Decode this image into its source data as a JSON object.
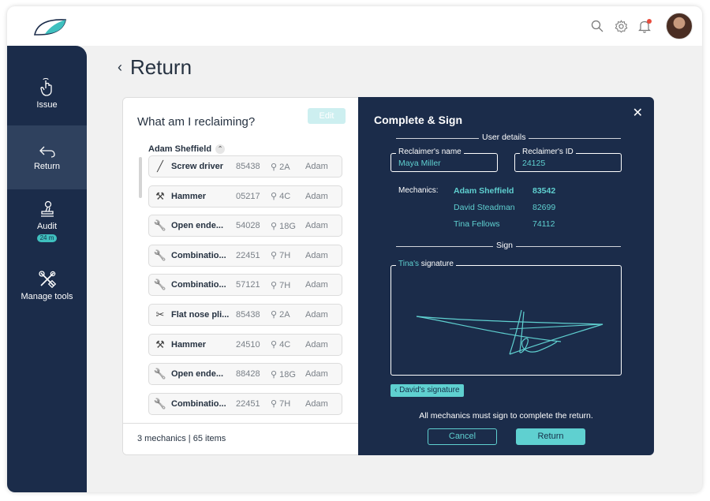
{
  "header": {
    "logo_icon": "leaf-logo",
    "icons": [
      "search-icon",
      "gear-icon",
      "bell-icon"
    ]
  },
  "sidebar": {
    "items": [
      {
        "label": "Issue",
        "icon": "hand-tap-icon"
      },
      {
        "label": "Return",
        "icon": "return-arrow-icon",
        "active": true
      },
      {
        "label": "Audit",
        "icon": "stamp-icon",
        "badge": "24 m"
      },
      {
        "label": "Manage tools",
        "icon": "tools-icon"
      }
    ]
  },
  "page": {
    "back_icon": "chevron-left-icon",
    "title": "Return"
  },
  "left_panel": {
    "heading": "What am I reclaiming?",
    "edit_label": "Edit",
    "group_name": "Adam Sheffield",
    "tools": [
      {
        "icon": "screwdriver-icon",
        "name": "Screw driver",
        "id": "85438",
        "location": "2A",
        "owner": "Adam"
      },
      {
        "icon": "hammer-icon",
        "name": "Hammer",
        "id": "05217",
        "location": "4C",
        "owner": "Adam"
      },
      {
        "icon": "wrench-icon",
        "name": "Open ende...",
        "id": "54028",
        "location": "18G",
        "owner": "Adam"
      },
      {
        "icon": "wrench-icon",
        "name": "Combinatio...",
        "id": "22451",
        "location": "7H",
        "owner": "Adam"
      },
      {
        "icon": "wrench-icon",
        "name": "Combinatio...",
        "id": "57121",
        "location": "7H",
        "owner": "Adam"
      },
      {
        "icon": "pliers-icon",
        "name": "Flat nose pli...",
        "id": "85438",
        "location": "2A",
        "owner": "Adam"
      },
      {
        "icon": "hammer-icon",
        "name": "Hammer",
        "id": "24510",
        "location": "4C",
        "owner": "Adam"
      },
      {
        "icon": "wrench-icon",
        "name": "Open ende...",
        "id": "88428",
        "location": "18G",
        "owner": "Adam"
      },
      {
        "icon": "wrench-icon",
        "name": "Combinatio...",
        "id": "22451",
        "location": "7H",
        "owner": "Adam"
      }
    ],
    "footer": "3 mechanics | 65 items"
  },
  "right_panel": {
    "title": "Complete & Sign",
    "user_details_label": "User details",
    "reclaimer_name_label": "Reclaimer's name",
    "reclaimer_name": "Maya Miller",
    "reclaimer_id_label": "Reclaimer's ID",
    "reclaimer_id": "24125",
    "mechanics_label": "Mechanics:",
    "mechanics": [
      {
        "name": "Adam Sheffield",
        "id": "83542"
      },
      {
        "name": "David Steadman",
        "id": "82699"
      },
      {
        "name": "Tina Fellows",
        "id": "74112"
      }
    ],
    "sign_label": "Sign",
    "signature_owner": "Tina's",
    "signature_suffix": " signature",
    "prev_signature": "David's signature",
    "footnote": "All mechanics must sign to complete the return.",
    "cancel_label": "Cancel",
    "return_label": "Return"
  }
}
